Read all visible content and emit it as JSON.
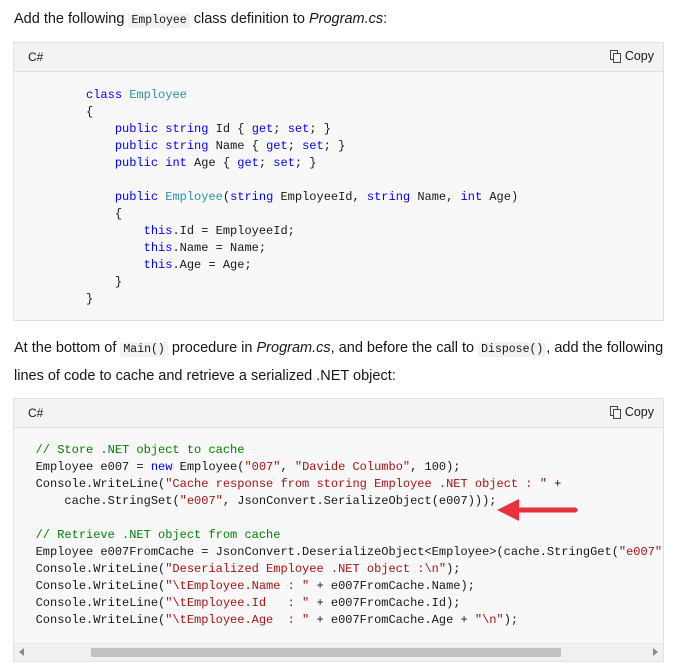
{
  "intro": {
    "prefix": "Add the following ",
    "code": "Employee",
    "middle": " class definition to ",
    "file": "Program.cs",
    "suffix": ":"
  },
  "block1": {
    "lang": "C#",
    "copy_label": "Copy"
  },
  "para2": {
    "line1_prefix": "At the bottom of ",
    "line1_code1": "Main()",
    "line1_mid1": " procedure in ",
    "line1_file": "Program.cs",
    "line1_mid2": ", and before the call to ",
    "line1_code2": "Dispose()",
    "line1_suffix": ", add the following",
    "line2": "lines of code to cache and retrieve a serialized .NET object:"
  },
  "block2": {
    "lang": "C#",
    "copy_label": "Copy"
  },
  "code1": {
    "l1": [
      "class",
      " ",
      "Employee"
    ],
    "l2": "{",
    "l3": [
      "public",
      " ",
      "string",
      " Id { ",
      "get",
      "; ",
      "set",
      "; }"
    ],
    "l4": [
      "public",
      " ",
      "string",
      " Name { ",
      "get",
      "; ",
      "set",
      "; }"
    ],
    "l5": [
      "public",
      " ",
      "int",
      " Age { ",
      "get",
      "; ",
      "set",
      "; }"
    ],
    "l6": [
      "public",
      " ",
      "Employee",
      "(",
      "string",
      " EmployeeId, ",
      "string",
      " Name, ",
      "int",
      " Age)"
    ],
    "l7": "{",
    "l8": [
      "this",
      ".Id = EmployeeId;"
    ],
    "l9": [
      "this",
      ".Name = Name;"
    ],
    "l10": [
      "this",
      ".Age = Age;"
    ],
    "l11": "}",
    "l12": "}"
  },
  "code2": {
    "c1": "// Store .NET object to cache",
    "l2": [
      "Employee e007 = ",
      "new",
      " Employee(",
      "\"007\"",
      ", ",
      "\"Davide Columbo\"",
      ", 100);"
    ],
    "l3": [
      "Console.WriteLine(",
      "\"Cache response from storing Employee .NET object : \"",
      " +"
    ],
    "l4": [
      "cache.StringSet(",
      "\"e007\"",
      ", JsonConvert.SerializeObject(e007)));"
    ],
    "c2": "// Retrieve .NET object from cache",
    "l6": [
      "Employee e007FromCache = JsonConvert.DeserializeObject<Employee>(cache.StringGet(",
      "\"e007\"",
      "));"
    ],
    "l7": [
      "Console.WriteLine(",
      "\"Deserialized Employee .NET object :\\n\"",
      ");"
    ],
    "l8": [
      "Console.WriteLine(",
      "\"\\tEmployee.Name : \"",
      " + e007FromCache.Name);"
    ],
    "l9": [
      "Console.WriteLine(",
      "\"\\tEmployee.Id   : \"",
      " + e007FromCache.Id);"
    ],
    "l10": [
      "Console.WriteLine(",
      "\"\\tEmployee.Age  : \"",
      " + e007FromCache.Age + ",
      "\"\\n\"",
      ");"
    ]
  },
  "colors": {
    "keyword": "#0101fd",
    "type": "#2b91af",
    "string": "#a31515",
    "comment": "#008000",
    "annotation_arrow": "#e8313a"
  },
  "icons": {
    "copy": "copy-icon",
    "annotation": "red-arrow-icon"
  }
}
